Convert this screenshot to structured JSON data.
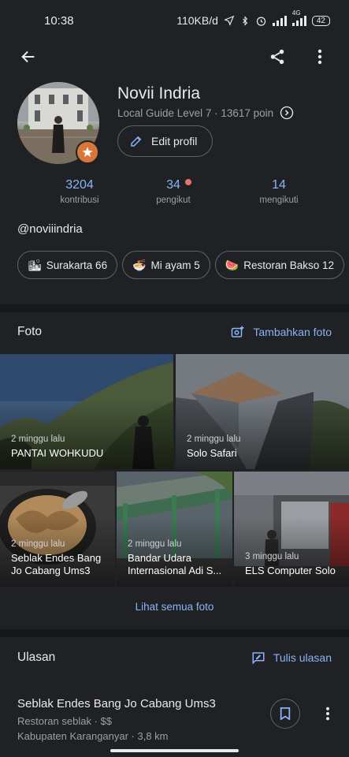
{
  "status_bar": {
    "time": "10:38",
    "speed": "110KB/d",
    "network": "4G",
    "battery": "42"
  },
  "profile": {
    "name": "Novii Indria",
    "level": "Local Guide Level 7 · 13617 poin",
    "edit_label": "Edit profil",
    "username": "@noviiindria"
  },
  "stats": [
    {
      "value": "3204",
      "label": "kontribusi"
    },
    {
      "value": "34",
      "label": "pengikut"
    },
    {
      "value": "14",
      "label": "mengikuti"
    }
  ],
  "chips": [
    {
      "emoji": "🏙",
      "label": "Surakarta 66"
    },
    {
      "emoji": "🍜",
      "label": "Mi ayam 5"
    },
    {
      "emoji": "🍉",
      "label": "Restoran Bakso 12"
    }
  ],
  "photos_section": {
    "title": "Foto",
    "add_label": "Tambahkan foto",
    "see_all": "Lihat semua foto",
    "items": [
      {
        "time": "2 minggu lalu",
        "title": "PANTAI WOHKUDU"
      },
      {
        "time": "2 minggu lalu",
        "title": "Solo Safari"
      },
      {
        "time": "2 minggu lalu",
        "title": "Seblak Endes Bang",
        "title2": "Jo Cabang Ums3"
      },
      {
        "time": "2 minggu lalu",
        "title": "Bandar Udara",
        "title2": "Internasional Adi S..."
      },
      {
        "time": "3 minggu lalu",
        "title": "ELS Computer Solo"
      }
    ]
  },
  "reviews_section": {
    "title": "Ulasan",
    "write_label": "Tulis ulasan",
    "item": {
      "title": "Seblak Endes Bang Jo Cabang Ums3",
      "category": "Restoran seblak · $$",
      "location": "Kabupaten Karanganyar · 3,8 km"
    }
  },
  "colors": {
    "background": "#202124",
    "accent": "#8ab4f8",
    "badge": "#d9773a"
  },
  "icons": [
    "back-arrow-icon",
    "share-icon",
    "more-vert-icon",
    "chevron-right-icon",
    "pencil-icon",
    "add-photo-icon",
    "rate-review-icon",
    "bookmark-icon"
  ]
}
